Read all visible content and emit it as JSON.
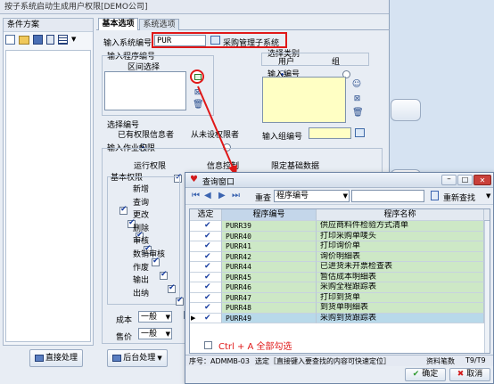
{
  "main_window": {
    "title": "按子系统启动生成用户权限[DEMO公司]"
  },
  "left_panel": {
    "label": "条件方案"
  },
  "tabs": [
    "基本选项",
    "系统选项"
  ],
  "form": {
    "system_code_label": "输入系统编号",
    "system_code_value": "PUR",
    "system_name": "采购管理子系统",
    "program_group_label": "输入程序编号",
    "range_select_label": "区间选择",
    "select_category_label": "选择类别",
    "category_user": "用户",
    "category_group": "组",
    "input_code_label": "输入编号",
    "select_code_label": "选择编号",
    "opt_has_perm": "已有权限信息者",
    "opt_no_perm": "从未设权限者",
    "input_group_label": "输入组编号",
    "job_perm_label": "输入作业权限",
    "run_perm": "运行权限",
    "info_control": "信息控制",
    "limit_basic": "限定基础数据",
    "basic_perm_label": "基本权限",
    "perms": [
      "新增",
      "查询",
      "更改",
      "删除",
      "审核",
      "数销审核",
      "作废",
      "输出",
      "出纳"
    ],
    "cost_label": "成本",
    "cost_value": "一般",
    "price_label": "售价",
    "price_value": "一般"
  },
  "bottom_buttons": {
    "direct": "直接处理",
    "background": "后台处理"
  },
  "query_window": {
    "title": "查询窗口",
    "resort_label": "重查",
    "resort_value": "程序编号",
    "requery": "重新查找",
    "col_select": "选定",
    "col_code": "程序编号",
    "col_name": "程序名称",
    "rows": [
      {
        "code": "PURR39",
        "name": "供应商料件检验方式清单"
      },
      {
        "code": "PURR40",
        "name": "打印采购单唛头"
      },
      {
        "code": "PURR41",
        "name": "打印询价单"
      },
      {
        "code": "PURR42",
        "name": "询价明细表"
      },
      {
        "code": "PURR44",
        "name": "已进货未开票检查表"
      },
      {
        "code": "PURR45",
        "name": "暂估成本明细表"
      },
      {
        "code": "PURR46",
        "name": "采购全程跟踪表"
      },
      {
        "code": "PURR47",
        "name": "打印到货单"
      },
      {
        "code": "PURR48",
        "name": "到货单明细表"
      },
      {
        "code": "PURR49",
        "name": "采购到货跟踪表"
      }
    ],
    "hint": "Ctrl + A 全部勾选",
    "status_seq": "序号：ADMMB-03",
    "status_hint": "选定［直接键入要查找的内容可快速定位］",
    "status_count_label": "资料笔数",
    "status_count": "T9/T9",
    "ok": "确定",
    "cancel": "取消"
  },
  "colors": {
    "accent_red": "#e01818",
    "row_green": "#cde8c6",
    "row_selected": "#b8d9ea",
    "yellow_field": "#ffffc4"
  },
  "icons": [
    "new-icon",
    "open-icon",
    "save-icon",
    "delete-icon",
    "list-icon",
    "copy-icon",
    "search-icon",
    "first-icon",
    "prev-icon",
    "next-icon",
    "last-icon"
  ]
}
